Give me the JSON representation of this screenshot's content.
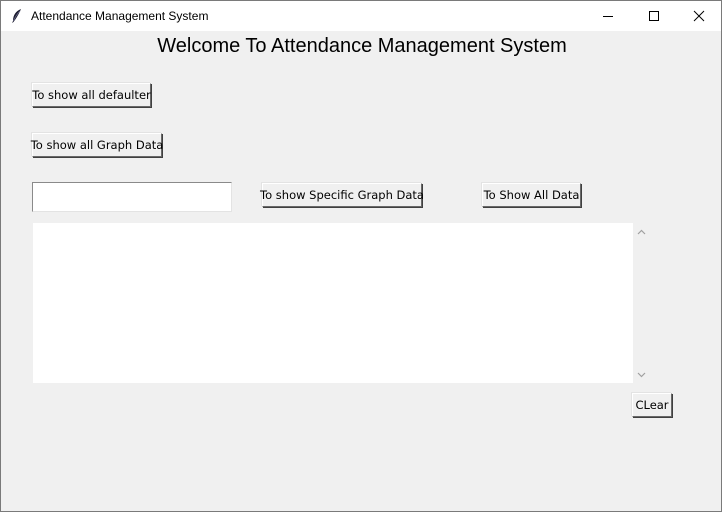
{
  "window": {
    "title": "Attendance Management System"
  },
  "heading": "Welcome To Attendance Management System",
  "buttons": {
    "show_defaulter": "To show all defaulter",
    "show_all_graph": "To show all Graph Data",
    "show_specific_graph": "To show Specific Graph Data",
    "show_all_data": "To Show All Data",
    "clear": "CLear"
  },
  "entry": {
    "value": ""
  },
  "output": {
    "text": ""
  }
}
